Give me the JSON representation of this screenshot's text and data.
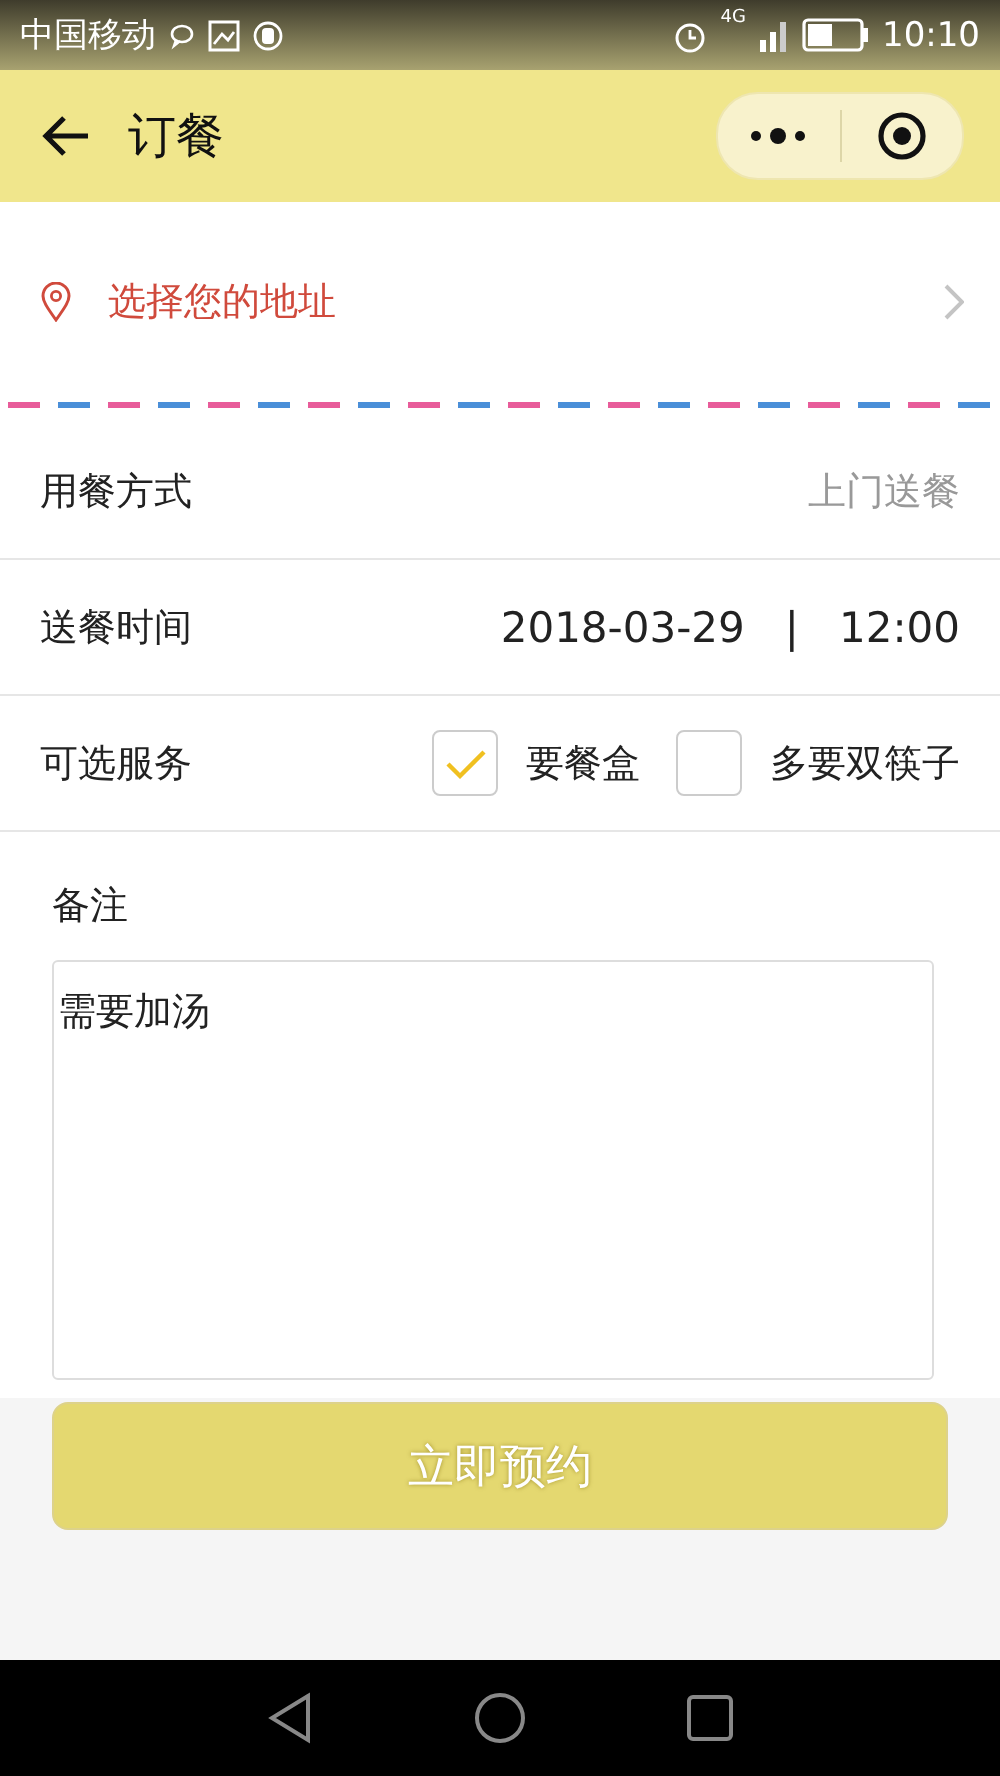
{
  "status_bar": {
    "carrier": "中国移动",
    "network": "4G",
    "time": "10:10"
  },
  "header": {
    "title": "订餐"
  },
  "address": {
    "label": "选择您的地址"
  },
  "form": {
    "rows": [
      {
        "kind": "value",
        "label": "用餐方式",
        "value": "上门送餐",
        "muted": true
      },
      {
        "kind": "datetime",
        "label": "送餐时间",
        "date": "2018-03-29",
        "separator": "|",
        "time": "12:00"
      },
      {
        "kind": "checkboxes",
        "label": "可选服务",
        "options": [
          {
            "label": "要餐盒",
            "checked": true
          },
          {
            "label": "多要双筷子",
            "checked": false
          }
        ]
      }
    ]
  },
  "note": {
    "label": "备注",
    "value": "需要加汤"
  },
  "submit": {
    "label": "立即预约",
    "disabled": true
  }
}
